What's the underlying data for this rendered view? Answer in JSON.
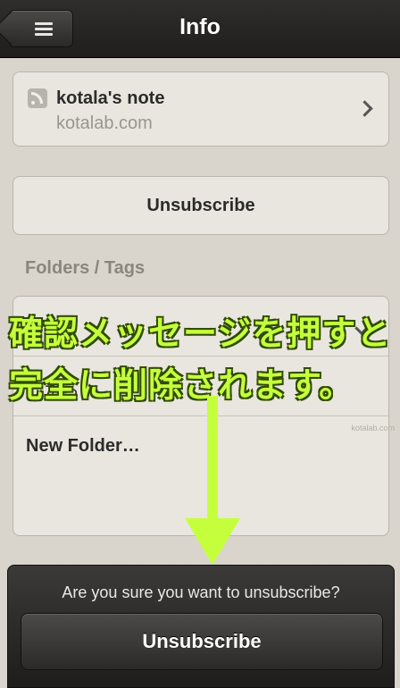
{
  "nav": {
    "title": "Info"
  },
  "feed": {
    "name": "kotala's note",
    "url": "kotalab.com"
  },
  "actions": {
    "unsubscribe_label": "Unsubscribe"
  },
  "folders": {
    "section_label": "Folders / Tags",
    "items": [
      {
        "label": "",
        "checked": true
      },
      {
        "label": "こたら",
        "checked": false
      },
      {
        "label": "New Folder…",
        "checked": false
      }
    ]
  },
  "annotation": {
    "line1": "確認メッセージを押すと",
    "line2": "完全に削除されます。"
  },
  "watermark": "kotalab.com",
  "action_sheet": {
    "message": "Are you sure you want to unsubscribe?",
    "confirm_label": "Unsubscribe"
  },
  "colors": {
    "annotation": "#c5ff3c",
    "nav_bg": "#2f2e2c",
    "page_bg": "#d9d5cc"
  }
}
